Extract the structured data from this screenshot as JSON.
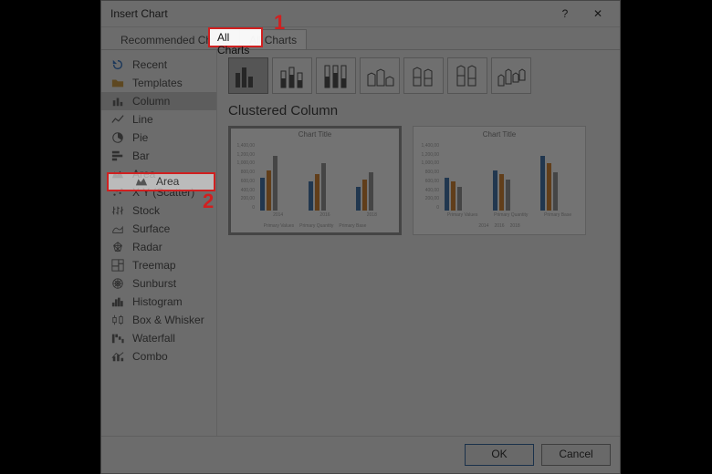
{
  "dialog": {
    "title": "Insert Chart",
    "help_icon": "?",
    "close_icon": "✕",
    "tabs": {
      "recommended": "Recommended Charts",
      "all": "All Charts"
    },
    "ok": "OK",
    "cancel": "Cancel"
  },
  "chart_types": [
    {
      "key": "recent",
      "label": "Recent"
    },
    {
      "key": "templates",
      "label": "Templates"
    },
    {
      "key": "column",
      "label": "Column",
      "selected": true
    },
    {
      "key": "line",
      "label": "Line"
    },
    {
      "key": "pie",
      "label": "Pie"
    },
    {
      "key": "bar",
      "label": "Bar"
    },
    {
      "key": "area",
      "label": "Area"
    },
    {
      "key": "xy",
      "label": "X Y (Scatter)"
    },
    {
      "key": "stock",
      "label": "Stock"
    },
    {
      "key": "surface",
      "label": "Surface"
    },
    {
      "key": "radar",
      "label": "Radar"
    },
    {
      "key": "treemap",
      "label": "Treemap"
    },
    {
      "key": "sunburst",
      "label": "Sunburst"
    },
    {
      "key": "histogram",
      "label": "Histogram"
    },
    {
      "key": "boxwhisker",
      "label": "Box & Whisker"
    },
    {
      "key": "waterfall",
      "label": "Waterfall"
    },
    {
      "key": "combo",
      "label": "Combo"
    }
  ],
  "subtype_heading": "Clustered Column",
  "previews": {
    "title": "Chart Title",
    "y_ticks": [
      "1,400,00",
      "1,200,00",
      "1,000,00",
      "800,00",
      "600,00",
      "400,00",
      "200,00",
      "0"
    ],
    "p1_x": [
      "2014",
      "2016",
      "2018"
    ],
    "p1_legend": [
      "Primary Values",
      "Primary Quantity",
      "Primary Base"
    ],
    "p2_x": [
      "Primary Values",
      "Primary Quantity",
      "Primary Base"
    ],
    "p2_legend": [
      "2014",
      "2016",
      "2018"
    ]
  },
  "callouts": {
    "one": "1",
    "two": "2"
  },
  "colors": {
    "highlight": "#d02020",
    "bar1": "#4a7ab0",
    "bar2": "#d88b3a",
    "bar3": "#9a9a9a",
    "ok_border": "#3a6ea5"
  }
}
